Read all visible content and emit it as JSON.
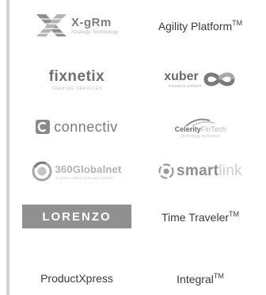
{
  "logos": {
    "xgrm": {
      "name": "X-gRm",
      "tagline": "Strategy Technology",
      "icon": "x-grm-mark-icon"
    },
    "agility": {
      "name": "Agility Platform",
      "tm": "TM"
    },
    "fixnetix": {
      "name": "fixnetix",
      "tagline": "TRADING SERVICES"
    },
    "xuber": {
      "name": "xuber",
      "tagline": "insurance software",
      "icon": "infinity-loop-icon"
    },
    "connectiv": {
      "name": "connectiv",
      "icon": "connectiv-c-icon"
    },
    "celerity": {
      "name_a": "Celerity",
      "name_b": "FinTech",
      "tagline": "Technology in Finance",
      "icon": "swoosh-icon"
    },
    "globalnet": {
      "name": "360Globalnet",
      "tagline": "Innovation delivered through platform",
      "icon": "globe-ring-icon"
    },
    "smartlink": {
      "name_a": "smart",
      "name_b": "link",
      "icon": "smartlink-swirl-icon"
    },
    "lorenzo": {
      "name": "LORENZO"
    },
    "timetraveler": {
      "name": "Time Traveler",
      "tm": "TM"
    },
    "productxpress": {
      "name": "ProductXpress"
    },
    "integral": {
      "name": "Integral",
      "tm": "TM"
    }
  },
  "colors": {
    "rule": "#d2d2d2",
    "logo_grey": "#8e8e8e",
    "text": "#3a3a3a"
  }
}
